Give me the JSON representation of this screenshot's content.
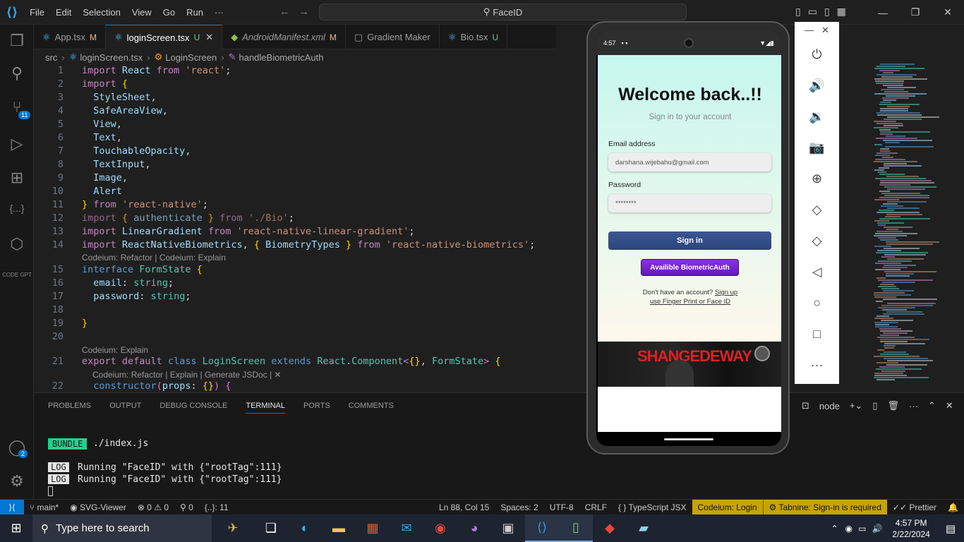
{
  "titlebar": {
    "menu": [
      "File",
      "Edit",
      "Selection",
      "View",
      "Go",
      "Run",
      "···"
    ],
    "command_center": "FaceID"
  },
  "activity": {
    "source_control_badge": "11",
    "accounts_badge": "2",
    "codegpt_label": "CODE GPT"
  },
  "tabs": [
    {
      "label": "App.tsx",
      "status": "M"
    },
    {
      "label": "loginScreen.tsx",
      "status": "U"
    },
    {
      "label": "AndroidManifest.xml",
      "status": "M"
    },
    {
      "label": "Gradient Maker",
      "status": ""
    },
    {
      "label": "Bio.tsx",
      "status": "U"
    }
  ],
  "breadcrumb": [
    "src",
    "loginScreen.tsx",
    "LoginScreen",
    "handleBiometricAuth"
  ],
  "editor": {
    "lens_refactor": "Codeium: Refactor | Codeium: Explain",
    "lens_explain": "Codeium: Explain",
    "lens_full": "Codeium: Refactor | Explain | Generate JSDoc | ✕"
  },
  "panel": {
    "tabs": [
      "PROBLEMS",
      "OUTPUT",
      "DEBUG CONSOLE",
      "TERMINAL",
      "PORTS",
      "COMMENTS"
    ],
    "active_tab": "TERMINAL",
    "bundle_tag": "BUNDLE",
    "bundle_path": "./index.js",
    "log_tag": "LOG",
    "log_lines": [
      "Running \"FaceID\" with {\"rootTag\":111}",
      "Running \"FaceID\" with {\"rootTag\":111}"
    ],
    "terminal_name": "node"
  },
  "phone": {
    "time": "4:57",
    "welcome": "Welcome back..!!",
    "subtitle": "Sign in to your account",
    "email_label": "Email address",
    "email_value": "darshana.wijebahu@gmail.com",
    "password_label": "Password",
    "password_value": "********",
    "signin_button": "Sign in",
    "bio_button": "Availible BiometricAuth",
    "hint_text": "Don't have an account?",
    "hint_link": "Sign up",
    "hint_line2": "use Finger Print or Face ID",
    "banner_title": "SHANGEDEWAY"
  },
  "statusbar": {
    "branch": "main*",
    "svg_viewer": "SVG-Viewer",
    "problems": "⊗ 0 ⚠ 0",
    "ports": "⚲ 0",
    "brackets": "{..}: 11",
    "position": "Ln 88, Col 15",
    "spaces": "Spaces: 2",
    "encoding": "UTF-8",
    "eol": "CRLF",
    "language": "TypeScript JSX",
    "codeium": "Codeium: Login",
    "tabnine": "Tabnine: Sign-in is required",
    "prettier": "Prettier"
  },
  "taskbar": {
    "search_placeholder": "Type here to search",
    "time": "4:57 PM",
    "date": "2/22/2024"
  }
}
